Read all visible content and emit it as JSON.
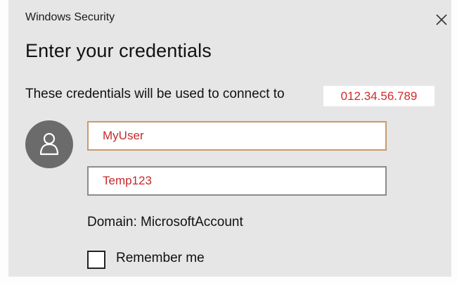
{
  "window": {
    "title": "Windows Security",
    "close_icon": "close-icon"
  },
  "dialog": {
    "heading": "Enter your credentials",
    "description": "These credentials will be used to connect to",
    "server_address": "012.34.56.789"
  },
  "account": {
    "avatar_icon": "user-icon",
    "username_value": "MyUser",
    "password_value": "Temp123",
    "domain_text": "Domain: MicrosoftAccount"
  },
  "options": {
    "remember_label": "Remember me",
    "remember_checked": false
  },
  "colors": {
    "background": "#e6e6e6",
    "entered_value_text": "#c62a2a",
    "username_border": "#c99a6c",
    "avatar_background": "#6b6b6b"
  }
}
